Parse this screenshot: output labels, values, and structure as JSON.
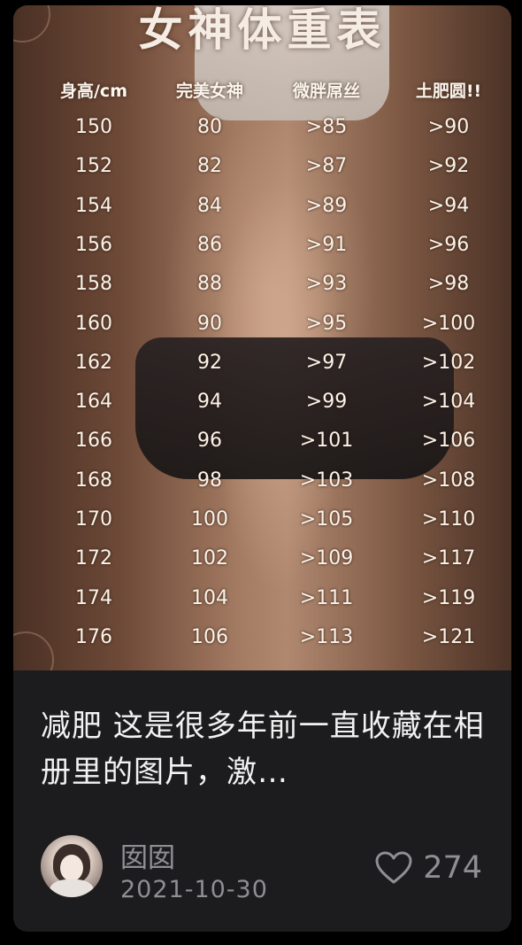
{
  "post": {
    "image_table": {
      "title": "女神体重表",
      "headers": [
        "身高/cm",
        "完美女神",
        "微胖屌丝",
        "土肥圆!!"
      ],
      "rows": [
        [
          "150",
          "80",
          ">85",
          ">90"
        ],
        [
          "152",
          "82",
          ">87",
          ">92"
        ],
        [
          "154",
          "84",
          ">89",
          ">94"
        ],
        [
          "156",
          "86",
          ">91",
          ">96"
        ],
        [
          "158",
          "88",
          ">93",
          ">98"
        ],
        [
          "160",
          "90",
          ">95",
          ">100"
        ],
        [
          "162",
          "92",
          ">97",
          ">102"
        ],
        [
          "164",
          "94",
          ">99",
          ">104"
        ],
        [
          "166",
          "96",
          ">101",
          ">106"
        ],
        [
          "168",
          "98",
          ">103",
          ">108"
        ],
        [
          "170",
          "100",
          ">105",
          ">110"
        ],
        [
          "172",
          "102",
          ">109",
          ">117"
        ],
        [
          "174",
          "104",
          ">111",
          ">119"
        ],
        [
          "176",
          "106",
          ">113",
          ">121"
        ]
      ]
    },
    "caption": "减肥 这是很多年前一直收藏在相册里的图片，激…",
    "author": "囡囡",
    "date": "2021-10-30",
    "like_count": "274",
    "icons": {
      "like": "heart-outline-icon",
      "avatar": "user-avatar"
    },
    "colors": {
      "card_bg": "#1c1c1e",
      "meta_text": "#8e8e93",
      "caption_text": "#f2f2f2"
    }
  }
}
